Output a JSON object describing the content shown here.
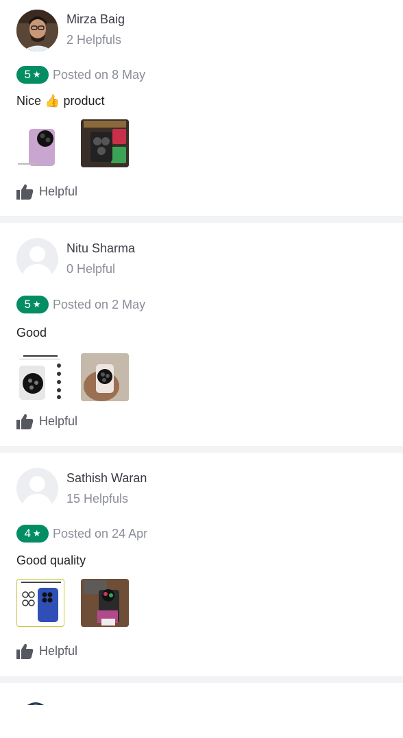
{
  "reviews": [
    {
      "name": "Mirza Baig",
      "helpfuls": "2 Helpfuls",
      "rating": "5",
      "posted": "Posted on 8 May",
      "text_before": "Nice",
      "emoji": "👍",
      "text_after": "product",
      "helpful_label": "Helpful"
    },
    {
      "name": "Nitu Sharma",
      "helpfuls": "0 Helpful",
      "rating": "5",
      "posted": "Posted on 2 May",
      "text": "Good",
      "helpful_label": "Helpful"
    },
    {
      "name": "Sathish Waran",
      "helpfuls": "15 Helpfuls",
      "rating": "4",
      "posted": "Posted on 24 Apr",
      "text": "Good quality",
      "helpful_label": "Helpful"
    }
  ],
  "icons": {
    "star": "★",
    "thumbs_up": "thumbs-up-icon"
  },
  "colors": {
    "rating_green": "#038d63",
    "muted_text": "#8b8e99",
    "divider": "#f2f3f5"
  }
}
